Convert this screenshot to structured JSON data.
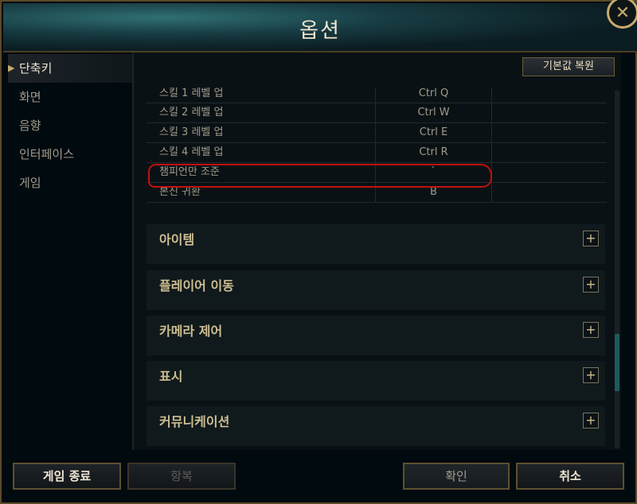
{
  "window": {
    "title": "옵션",
    "close_icon": "close-icon"
  },
  "sidebar": {
    "items": [
      {
        "label": "단축키",
        "active": true
      },
      {
        "label": "화면"
      },
      {
        "label": "음향"
      },
      {
        "label": "인터페이스"
      },
      {
        "label": "게임"
      }
    ]
  },
  "toolbar": {
    "restore_defaults_label": "기본값 복원"
  },
  "keybinds": {
    "rows": [
      {
        "name": "스킬 1 레벨 업",
        "key": "Ctrl  Q"
      },
      {
        "name": "스킬 2 레벨 업",
        "key": "Ctrl  W"
      },
      {
        "name": "스킬 3 레벨 업",
        "key": "Ctrl  E"
      },
      {
        "name": "스킬 4 레벨 업",
        "key": "Ctrl  R"
      },
      {
        "name": "챔피언만 조준",
        "key": "`"
      },
      {
        "name": "본진 귀환",
        "key": "B"
      }
    ]
  },
  "sections": [
    {
      "title": "아이템",
      "icon": "plus-icon"
    },
    {
      "title": "플레이어 이동",
      "icon": "plus-icon"
    },
    {
      "title": "카메라 제어",
      "icon": "plus-icon"
    },
    {
      "title": "표시",
      "icon": "plus-icon"
    },
    {
      "title": "커뮤니케이션",
      "icon": "plus-icon"
    }
  ],
  "footer": {
    "quit_label": "게임 종료",
    "surrender_label": "항복",
    "confirm_label": "확인",
    "cancel_label": "취소"
  },
  "colors": {
    "accent_gold": "#c8aa6e",
    "highlight_red": "#c01212",
    "background": "#010a0f"
  }
}
